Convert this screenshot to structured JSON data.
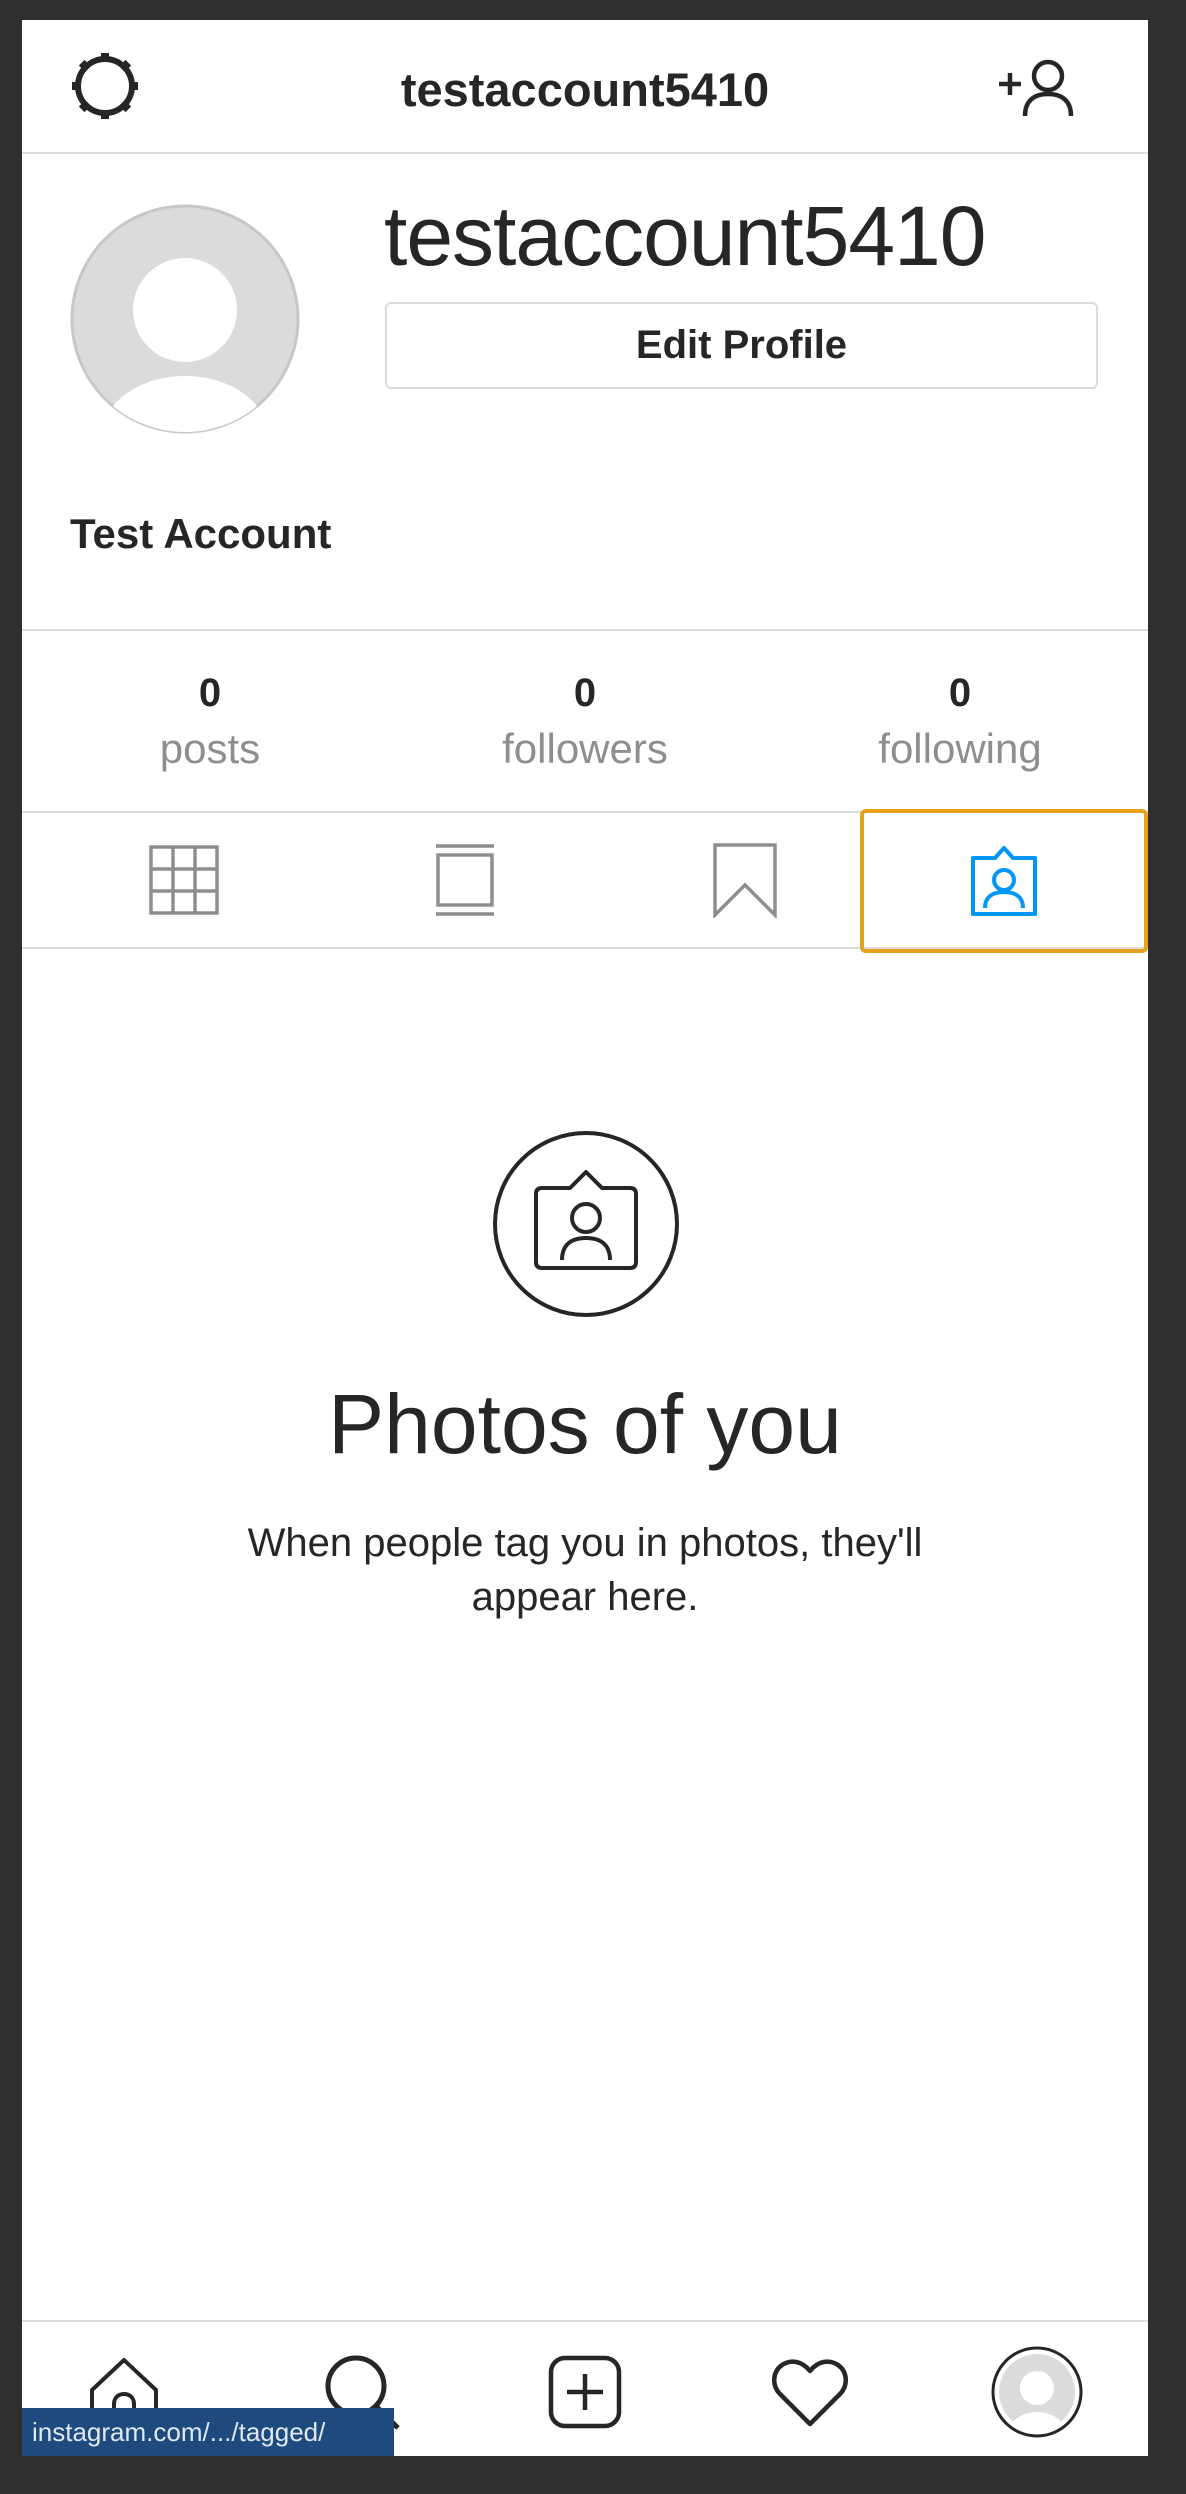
{
  "header": {
    "title": "testaccount5410",
    "left_icon": "gear-icon",
    "right_icon": "add-user-icon"
  },
  "profile": {
    "username": "testaccount5410",
    "edit_button_label": "Edit Profile",
    "full_name": "Test Account"
  },
  "stats": [
    {
      "value": "0",
      "label": "posts"
    },
    {
      "value": "0",
      "label": "followers"
    },
    {
      "value": "0",
      "label": "following"
    }
  ],
  "tabs": [
    {
      "icon": "grid-icon",
      "active": false
    },
    {
      "icon": "feed-icon",
      "active": false
    },
    {
      "icon": "bookmark-icon",
      "active": false
    },
    {
      "icon": "tagged-icon",
      "active": true
    }
  ],
  "empty_state": {
    "icon": "tagged-photo-icon",
    "title": "Photos of you",
    "description": "When people tag you in photos, they'll appear here."
  },
  "bottom_nav": [
    {
      "icon": "home-icon"
    },
    {
      "icon": "search-icon"
    },
    {
      "icon": "new-post-icon"
    },
    {
      "icon": "heart-icon"
    },
    {
      "icon": "profile-avatar-icon"
    }
  ],
  "status_url": "instagram.com/.../tagged/",
  "colors": {
    "text": "#262626",
    "muted": "#8e8e8e",
    "border": "#dbdbdb",
    "accent_blue": "#0095f6",
    "focus_orange": "#e8a11b",
    "status_bg": "#1e4a7e"
  }
}
